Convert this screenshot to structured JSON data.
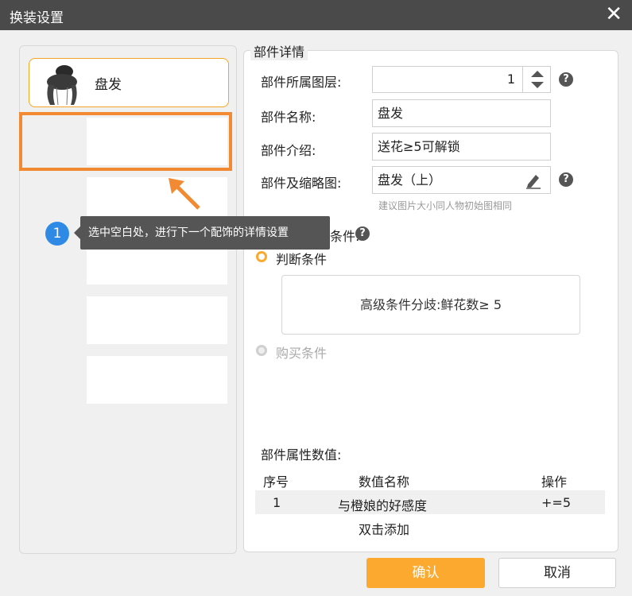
{
  "window": {
    "title": "换装设置",
    "close_icon": "close-icon"
  },
  "left": {
    "selected_item": {
      "label": "盘发"
    }
  },
  "guide": {
    "step_number": "1",
    "tooltip": "选中空白处，进行下一个配饰的详情设置"
  },
  "details": {
    "group_title": "部件详情",
    "layer_label": "部件所属图层:",
    "layer_value": "1",
    "name_label": "部件名称:",
    "name_value": "盘发",
    "intro_label": "部件介绍:",
    "intro_value": "送花≥5可解锁",
    "thumb_label": "部件及缩略图:",
    "thumb_value": "盘发（上）",
    "thumb_hint": "建议图片大小同人物初始图相同",
    "unlock_label": "条件:",
    "judge_label": "判断条件",
    "judge_summary": "高级条件分歧:鲜花数≥ 5",
    "buy_label": "购买条件"
  },
  "attributes": {
    "section_label": "部件属性数值:",
    "columns": [
      "序号",
      "数值名称",
      "操作"
    ],
    "rows": [
      {
        "index": "1",
        "name": "与橙娘的好感度",
        "op": "+=5"
      }
    ],
    "add_hint": "双击添加"
  },
  "buttons": {
    "ok": "确认",
    "cancel": "取消"
  },
  "colors": {
    "accent": "#fca930",
    "highlight": "#f28a33",
    "step": "#2f8ae5"
  }
}
